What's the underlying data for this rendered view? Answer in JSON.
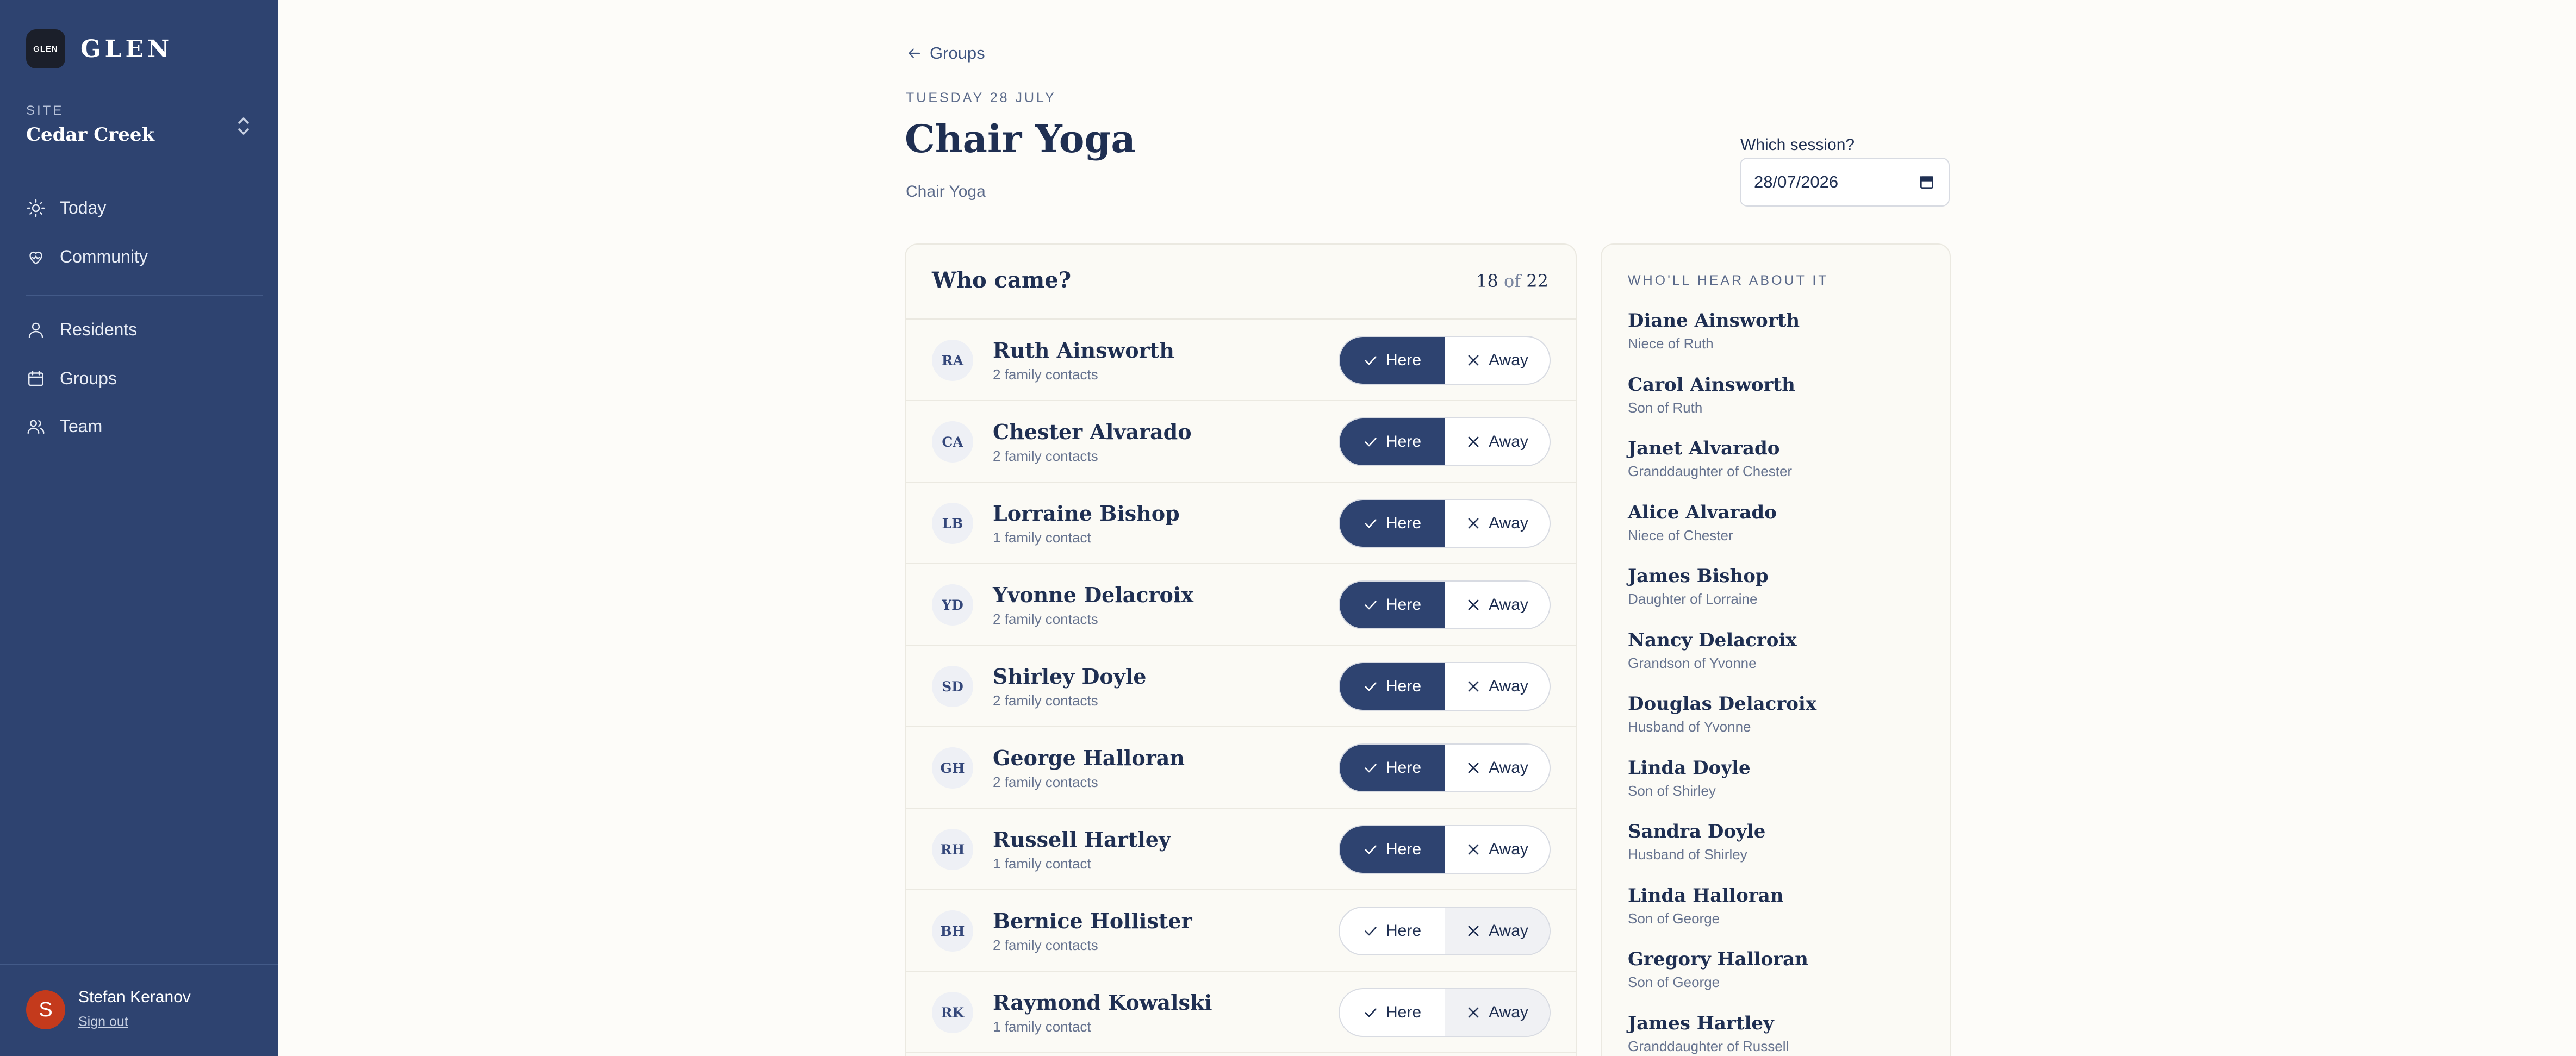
{
  "sidebar": {
    "logo_text": "GLEN",
    "brand_name": "GLEN",
    "site_label": "SITE",
    "site_name": "Cedar Creek",
    "nav_primary": [
      {
        "label": "Today",
        "icon": "sun-icon"
      },
      {
        "label": "Community",
        "icon": "heart-hands-icon"
      }
    ],
    "nav_secondary": [
      {
        "label": "Residents",
        "icon": "person-icon"
      },
      {
        "label": "Groups",
        "icon": "calendar-icon"
      },
      {
        "label": "Team",
        "icon": "users-icon"
      }
    ],
    "user": {
      "initial": "S",
      "name": "Stefan Keranov",
      "sign_out": "Sign out"
    }
  },
  "header": {
    "back_label": "Groups",
    "date": "TUESDAY 28 JULY",
    "title": "Chair Yoga",
    "subtitle": "Chair Yoga",
    "session_label": "Which session?",
    "session_value": "28/07/2026"
  },
  "attendance": {
    "title": "Who came?",
    "present": "18",
    "of": "of",
    "total": "22",
    "here_label": "Here",
    "away_label": "Away",
    "rows": [
      {
        "initials": "RA",
        "name": "Ruth Ainsworth",
        "contacts": "2 family contacts",
        "status": "here"
      },
      {
        "initials": "CA",
        "name": "Chester Alvarado",
        "contacts": "2 family contacts",
        "status": "here"
      },
      {
        "initials": "LB",
        "name": "Lorraine Bishop",
        "contacts": "1 family contact",
        "status": "here"
      },
      {
        "initials": "YD",
        "name": "Yvonne Delacroix",
        "contacts": "2 family contacts",
        "status": "here"
      },
      {
        "initials": "SD",
        "name": "Shirley Doyle",
        "contacts": "2 family contacts",
        "status": "here"
      },
      {
        "initials": "GH",
        "name": "George Halloran",
        "contacts": "2 family contacts",
        "status": "here"
      },
      {
        "initials": "RH",
        "name": "Russell Hartley",
        "contacts": "1 family contact",
        "status": "here"
      },
      {
        "initials": "BH",
        "name": "Bernice Hollister",
        "contacts": "2 family contacts",
        "status": "away"
      },
      {
        "initials": "RK",
        "name": "Raymond Kowalski",
        "contacts": "1 family contact",
        "status": "away"
      }
    ]
  },
  "notify": {
    "title": "WHO'LL HEAR ABOUT IT",
    "contacts": [
      {
        "name": "Diane Ainsworth",
        "relation": "Niece of Ruth"
      },
      {
        "name": "Carol Ainsworth",
        "relation": "Son of Ruth"
      },
      {
        "name": "Janet Alvarado",
        "relation": "Granddaughter of Chester"
      },
      {
        "name": "Alice Alvarado",
        "relation": "Niece of Chester"
      },
      {
        "name": "James Bishop",
        "relation": "Daughter of Lorraine"
      },
      {
        "name": "Nancy Delacroix",
        "relation": "Grandson of Yvonne"
      },
      {
        "name": "Douglas Delacroix",
        "relation": "Husband of Yvonne"
      },
      {
        "name": "Linda Doyle",
        "relation": "Son of Shirley"
      },
      {
        "name": "Sandra Doyle",
        "relation": "Husband of Shirley"
      },
      {
        "name": "Linda Halloran",
        "relation": "Son of George"
      },
      {
        "name": "Gregory Halloran",
        "relation": "Son of George"
      },
      {
        "name": "James Hartley",
        "relation": "Granddaughter of Russell"
      }
    ]
  },
  "colors": {
    "sidebar": "#2e4370",
    "accent": "#2e4370",
    "avatar": "#c43a1c",
    "background": "#fdfcf9"
  }
}
